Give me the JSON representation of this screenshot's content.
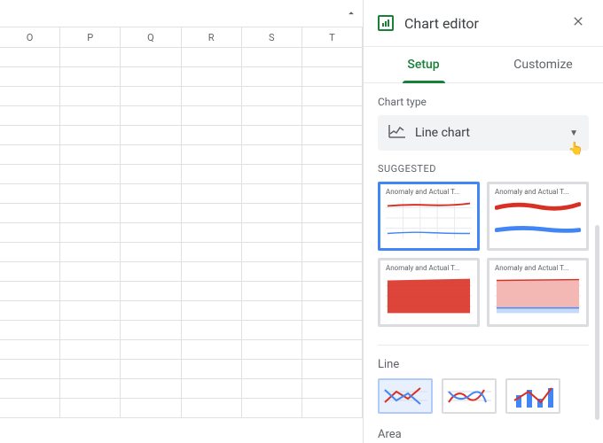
{
  "sheet": {
    "columns": [
      "O",
      "P",
      "Q",
      "R",
      "S",
      "T"
    ],
    "row_count": 19
  },
  "panel": {
    "title": "Chart editor",
    "tabs": {
      "setup": "Setup",
      "customize": "Customize",
      "active": "setup"
    },
    "chart_type_label": "Chart type",
    "chart_type_value": "Line chart",
    "suggested_label": "SUGGESTED",
    "suggested": [
      {
        "title": "Anomaly and Actual T...",
        "kind": "line",
        "selected": true
      },
      {
        "title": "Anomaly and Actual T...",
        "kind": "smooth"
      },
      {
        "title": "Anomaly and Actual T...",
        "kind": "area-solid"
      },
      {
        "title": "Anomaly and Actual T...",
        "kind": "area-stacked"
      }
    ],
    "categories": {
      "line": {
        "label": "Line"
      },
      "area": {
        "label": "Area"
      }
    }
  }
}
